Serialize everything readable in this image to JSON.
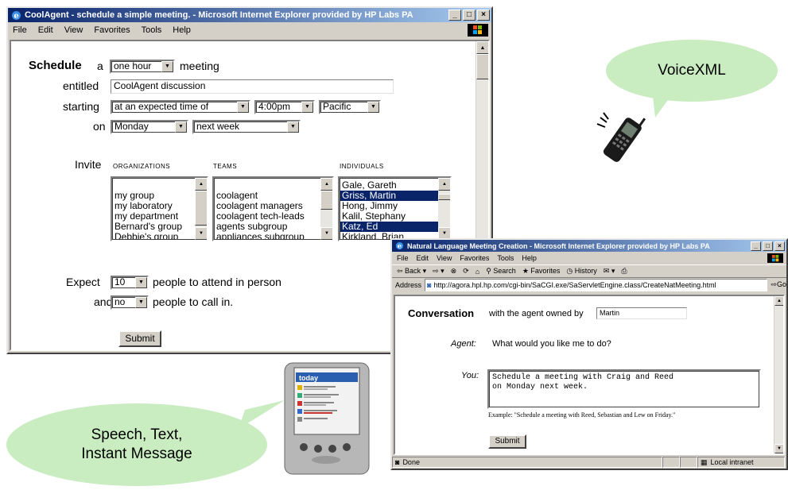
{
  "window1": {
    "title": "CoolAgent - schedule a simple meeting. - Microsoft Internet Explorer provided by HP Labs PA",
    "menu": [
      "File",
      "Edit",
      "View",
      "Favorites",
      "Tools",
      "Help"
    ],
    "form": {
      "schedule_label": "Schedule",
      "a_label": "a",
      "duration": "one hour",
      "meeting_label": "meeting",
      "entitled_label": "entitled",
      "entitled_value": "CoolAgent discussion",
      "starting_label": "starting",
      "starting_mode": "at an expected time of",
      "time": "4:00pm",
      "timezone": "Pacific",
      "on_label": "on",
      "day": "Monday",
      "week": "next week",
      "invite_label": "Invite",
      "organizations_header": "ORGANIZATIONS",
      "teams_header": "TEAMS",
      "individuals_header": "INDIVIDUALS",
      "organizations": [
        "my group",
        "my laboratory",
        "my department",
        "Bernard's group",
        "Debbie's group"
      ],
      "teams": [
        "coolagent",
        "coolagent managers",
        "coolagent tech-leads",
        "agents subgroup",
        "appliances subgroup"
      ],
      "individuals": [
        {
          "name": "Gale, Gareth",
          "selected": false
        },
        {
          "name": "Griss, Martin",
          "selected": true
        },
        {
          "name": "Hong, Jimmy",
          "selected": false
        },
        {
          "name": "Kalil, Stephany",
          "selected": false
        },
        {
          "name": "Katz, Ed",
          "selected": true
        },
        {
          "name": "Kirkland, Brian",
          "selected": false
        }
      ],
      "expect_label": "Expect",
      "expect_count": "10",
      "attend_label": "people to attend in person",
      "and_label": "and",
      "call_count": "no",
      "call_label": "people to call in.",
      "submit": "Submit"
    }
  },
  "window2": {
    "title": "Natural Language Meeting Creation - Microsoft Internet Explorer provided by HP Labs PA",
    "menu": [
      "File",
      "Edit",
      "View",
      "Favorites",
      "Tools",
      "Help"
    ],
    "toolbar": [
      "Back",
      "Search",
      "Favorites",
      "History"
    ],
    "address_label": "Address",
    "address": "http://agora.hpl.hp.com/cgi-bin/SaCGI.exe/SaServletEngine.class/CreateNatMeeting.html",
    "go": "Go",
    "conversation_label": "Conversation",
    "owned_label": "with the agent owned by",
    "owner": "Martin",
    "agent_label": "Agent:",
    "agent_text": "What would you like me to do?",
    "you_label": "You:",
    "you_text": "Schedule a meeting with Craig and Reed\non Monday next week.",
    "example": "Example: \"Schedule a meeting with Reed, Sebastian and Lew on Friday.\"",
    "submit": "Submit",
    "status_done": "Done",
    "status_zone": "Local intranet"
  },
  "bubbles": {
    "voice": "VoiceXML",
    "text": "Speech, Text,\nInstant Message"
  },
  "pda": {
    "screen_title": "today"
  },
  "colors": {
    "bubble": "#c9ecc1",
    "titlebar": "#0a246a",
    "selection": "#0a246a"
  }
}
